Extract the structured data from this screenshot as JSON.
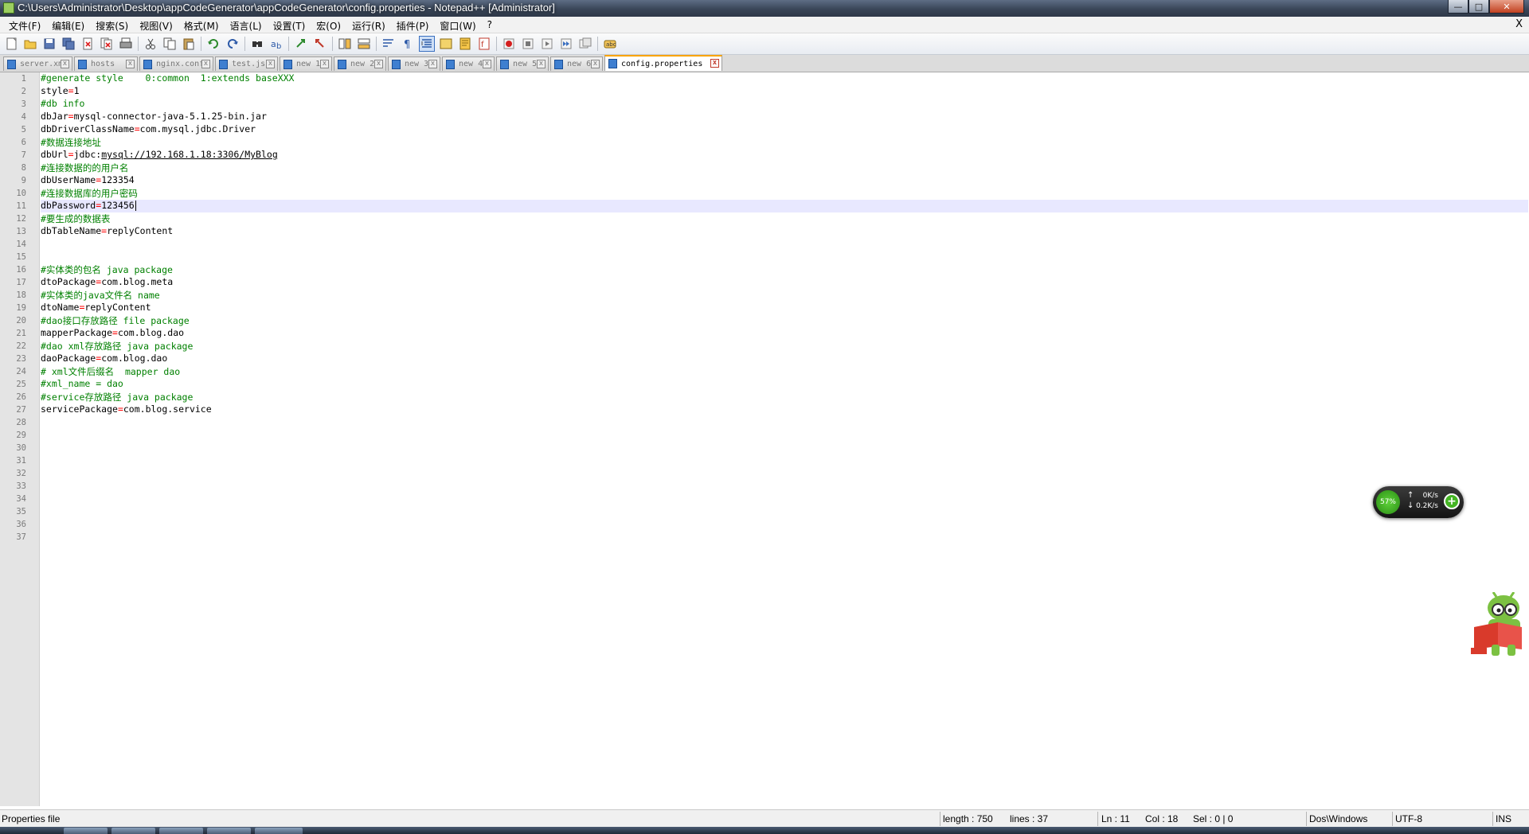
{
  "window": {
    "title": "C:\\Users\\Administrator\\Desktop\\appCodeGenerator\\appCodeGenerator\\config.properties - Notepad++ [Administrator]",
    "controls": {
      "minimize": "—",
      "maximize": "□",
      "close": "✕"
    }
  },
  "menu": {
    "items": [
      "文件(F)",
      "编辑(E)",
      "搜索(S)",
      "视图(V)",
      "格式(M)",
      "语言(L)",
      "设置(T)",
      "宏(O)",
      "运行(R)",
      "插件(P)",
      "窗口(W)",
      "?"
    ],
    "close_doc": "X"
  },
  "toolbar": {
    "buttons": [
      "new-file",
      "open-file",
      "save",
      "save-all",
      "close",
      "close-all",
      "print",
      "cut",
      "copy",
      "paste",
      "undo",
      "redo",
      "find",
      "replace",
      "zoom-in",
      "zoom-out",
      "sync-vertical",
      "sync-horizontal",
      "word-wrap",
      "show-all-chars",
      "indent-guide",
      "user-defined-language",
      "doc-map",
      "function-list",
      "macro-record",
      "macro-stop",
      "macro-play",
      "macro-play-multiple",
      "macro-save",
      "spell-check"
    ],
    "active": [
      "indent-guide"
    ]
  },
  "tabs": [
    {
      "label": "server.xml",
      "active": false
    },
    {
      "label": "hosts",
      "active": false
    },
    {
      "label": "nginx.conf",
      "active": false
    },
    {
      "label": "test.js",
      "active": false
    },
    {
      "label": "new 1",
      "active": false
    },
    {
      "label": "new 2",
      "active": false
    },
    {
      "label": "new 3",
      "active": false
    },
    {
      "label": "new 4",
      "active": false
    },
    {
      "label": "new 5",
      "active": false
    },
    {
      "label": "new 6",
      "active": false
    },
    {
      "label": "config.properties",
      "active": true
    }
  ],
  "editor": {
    "current_line": 11,
    "line_count": 37,
    "lines": [
      {
        "n": "1",
        "kind": "comment",
        "text": "#generate style    0:common  1:extends baseXXX"
      },
      {
        "n": "2",
        "kind": "kv",
        "key": "style",
        "value": "1"
      },
      {
        "n": "3",
        "kind": "comment",
        "text": "#db info"
      },
      {
        "n": "4",
        "kind": "kv",
        "key": "dbJar",
        "value": "mysql-connector-java-5.1.25-bin.jar"
      },
      {
        "n": "5",
        "kind": "kv",
        "key": "dbDriverClassName",
        "value": "com.mysql.jdbc.Driver"
      },
      {
        "n": "6",
        "kind": "comment",
        "text": "#数据连接地址"
      },
      {
        "n": "7",
        "kind": "kv",
        "key": "dbUrl",
        "value_prefix": "jdbc:",
        "value_link": "mysql://192.168.1.18:3306/MyBlog"
      },
      {
        "n": "8",
        "kind": "comment",
        "text": "#连接数据的的用户名"
      },
      {
        "n": "9",
        "kind": "kv",
        "key": "dbUserName",
        "value": "123354"
      },
      {
        "n": "10",
        "kind": "comment",
        "text": "#连接数据库的用户密码"
      },
      {
        "n": "11",
        "kind": "kv",
        "key": "dbPassword",
        "value": "123456"
      },
      {
        "n": "12",
        "kind": "comment",
        "text": "#要生成的数据表"
      },
      {
        "n": "13",
        "kind": "kv",
        "key": "dbTableName",
        "value": "replyContent"
      },
      {
        "n": "14",
        "kind": "empty"
      },
      {
        "n": "15",
        "kind": "empty"
      },
      {
        "n": "16",
        "kind": "comment",
        "text": "#实体类的包名 java package"
      },
      {
        "n": "17",
        "kind": "kv",
        "key": "dtoPackage",
        "value": "com.blog.meta"
      },
      {
        "n": "18",
        "kind": "comment",
        "text": "#实体类的java文件名 name"
      },
      {
        "n": "19",
        "kind": "kv",
        "key": "dtoName",
        "value": "replyContent"
      },
      {
        "n": "20",
        "kind": "comment",
        "text": "#dao接口存放路径 file package"
      },
      {
        "n": "21",
        "kind": "kv",
        "key": "mapperPackage",
        "value": "com.blog.dao"
      },
      {
        "n": "22",
        "kind": "comment",
        "text": "#dao xml存放路径 java package"
      },
      {
        "n": "23",
        "kind": "kv",
        "key": "daoPackage",
        "value": "com.blog.dao"
      },
      {
        "n": "24",
        "kind": "comment",
        "text": "# xml文件后缀名  mapper dao"
      },
      {
        "n": "25",
        "kind": "comment",
        "text": "#xml_name = dao"
      },
      {
        "n": "26",
        "kind": "comment",
        "text": "#service存放路径 java package"
      },
      {
        "n": "27",
        "kind": "kv",
        "key": "servicePackage",
        "value": "com.blog.service"
      },
      {
        "n": "28",
        "kind": "empty"
      },
      {
        "n": "29",
        "kind": "empty"
      },
      {
        "n": "30",
        "kind": "empty"
      },
      {
        "n": "31",
        "kind": "empty"
      },
      {
        "n": "32",
        "kind": "empty"
      },
      {
        "n": "33",
        "kind": "empty"
      },
      {
        "n": "34",
        "kind": "empty"
      },
      {
        "n": "35",
        "kind": "empty"
      },
      {
        "n": "36",
        "kind": "empty"
      },
      {
        "n": "37",
        "kind": "empty"
      }
    ]
  },
  "net_widget": {
    "percent": "57%",
    "up": "0K/s",
    "down": "0.2K/s",
    "plus": "+"
  },
  "status": {
    "file_type": "Properties file",
    "length": "length : 750",
    "lines": "lines : 37",
    "ln": "Ln : 11",
    "col": "Col : 18",
    "sel": "Sel : 0 | 0",
    "eol": "Dos\\Windows",
    "encoding": "UTF-8",
    "mode": "INS"
  },
  "colors": {
    "comment": "#008000",
    "operator": "#ff0000",
    "current_line": "#e8e8ff",
    "active_tab_accent": "#f9a400"
  }
}
